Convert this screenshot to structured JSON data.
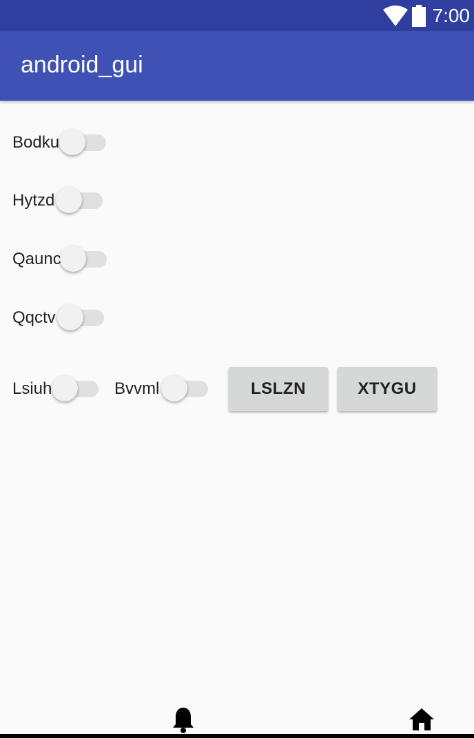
{
  "status_bar": {
    "time": "7:00",
    "icons": [
      "wifi-icon",
      "battery-icon"
    ]
  },
  "app_bar": {
    "title": "android_gui"
  },
  "switches": [
    {
      "label": "Bodku",
      "checked": false
    },
    {
      "label": "Hytzd",
      "checked": false
    },
    {
      "label": "Qaunc",
      "checked": false
    },
    {
      "label": "Qqctv",
      "checked": false
    },
    {
      "label": "Lsiuh",
      "checked": false
    },
    {
      "label": "Bvvml",
      "checked": false
    }
  ],
  "buttons": {
    "first": "LSLZN",
    "second": "XTYGU"
  },
  "bottom_nav": {
    "icons": [
      "bell-icon",
      "home-icon"
    ]
  },
  "colors": {
    "status_bar": "#303f9f",
    "app_bar": "#3f51b5",
    "background": "#fafafa",
    "button": "#d6d7d7"
  }
}
